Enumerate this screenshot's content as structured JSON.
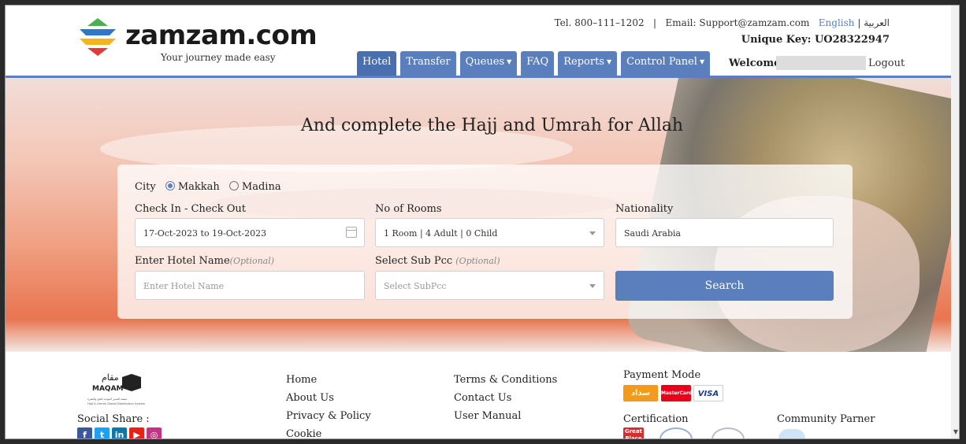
{
  "header": {
    "logo_text": "zamzam.com",
    "tagline": "Your journey made easy",
    "tel": "Tel. 800–111–1202",
    "separator": "|",
    "email": "Email: Support@zamzam.com",
    "lang_english": "English",
    "lang_arabic": "| العربية",
    "unique_key": "Unique Key: UO28322947",
    "welcome": "Welcome",
    "logout": "Logout"
  },
  "nav": {
    "hotel": "Hotel",
    "transfer": "Transfer",
    "queues": "Queues",
    "faq": "FAQ",
    "reports": "Reports",
    "control_panel": "Control Panel"
  },
  "hero": {
    "title": "And complete the Hajj and Umrah for Allah"
  },
  "search": {
    "city_label": "City",
    "city_makkah": "Makkah",
    "city_madina": "Madina",
    "city_selected": "Makkah",
    "checkin_label": "Check In - Check Out",
    "checkin_value": "17-Oct-2023 to 19-Oct-2023",
    "rooms_label": "No of Rooms",
    "rooms_value": "1 Room | 4 Adult | 0 Child",
    "nationality_label": "Nationality",
    "nationality_value": "Saudi Arabia",
    "hotel_name_label": "Enter Hotel Name",
    "hotel_name_optional": "(Optional)",
    "hotel_name_placeholder": "Enter Hotel Name",
    "subpcc_label": "Select Sub Pcc",
    "subpcc_optional": "(Optional)",
    "subpcc_placeholder": "Select SubPcc",
    "search_button": "Search"
  },
  "footer": {
    "maqam_ar": "مقام",
    "maqam_en": "MAQAM",
    "maqam_sub1": "منصة المدير الموحد للحج والعمرة",
    "maqam_sub2": "Hajj & Umrah Global Distribution System",
    "social_label": "Social Share :",
    "social_icons": [
      "facebook-icon",
      "twitter-icon",
      "linkedin-icon",
      "youtube-icon",
      "instagram-icon"
    ],
    "links_col1": [
      "Home",
      "About Us",
      "Privacy & Policy",
      "Cookie"
    ],
    "links_col2": [
      "Terms & Conditions",
      "Contact Us",
      "User Manual"
    ],
    "payment_label": "Payment Mode",
    "payment_sadad": "سداد",
    "payment_mastercard": "MasterCard",
    "payment_visa": "VISA",
    "certification_label": "Certification",
    "great_place": "Great Place",
    "community_label": "Community Parner"
  },
  "colors": {
    "accent": "#5b7fbc",
    "sadad": "#f29a1b",
    "visa": "#1a3d8f"
  }
}
